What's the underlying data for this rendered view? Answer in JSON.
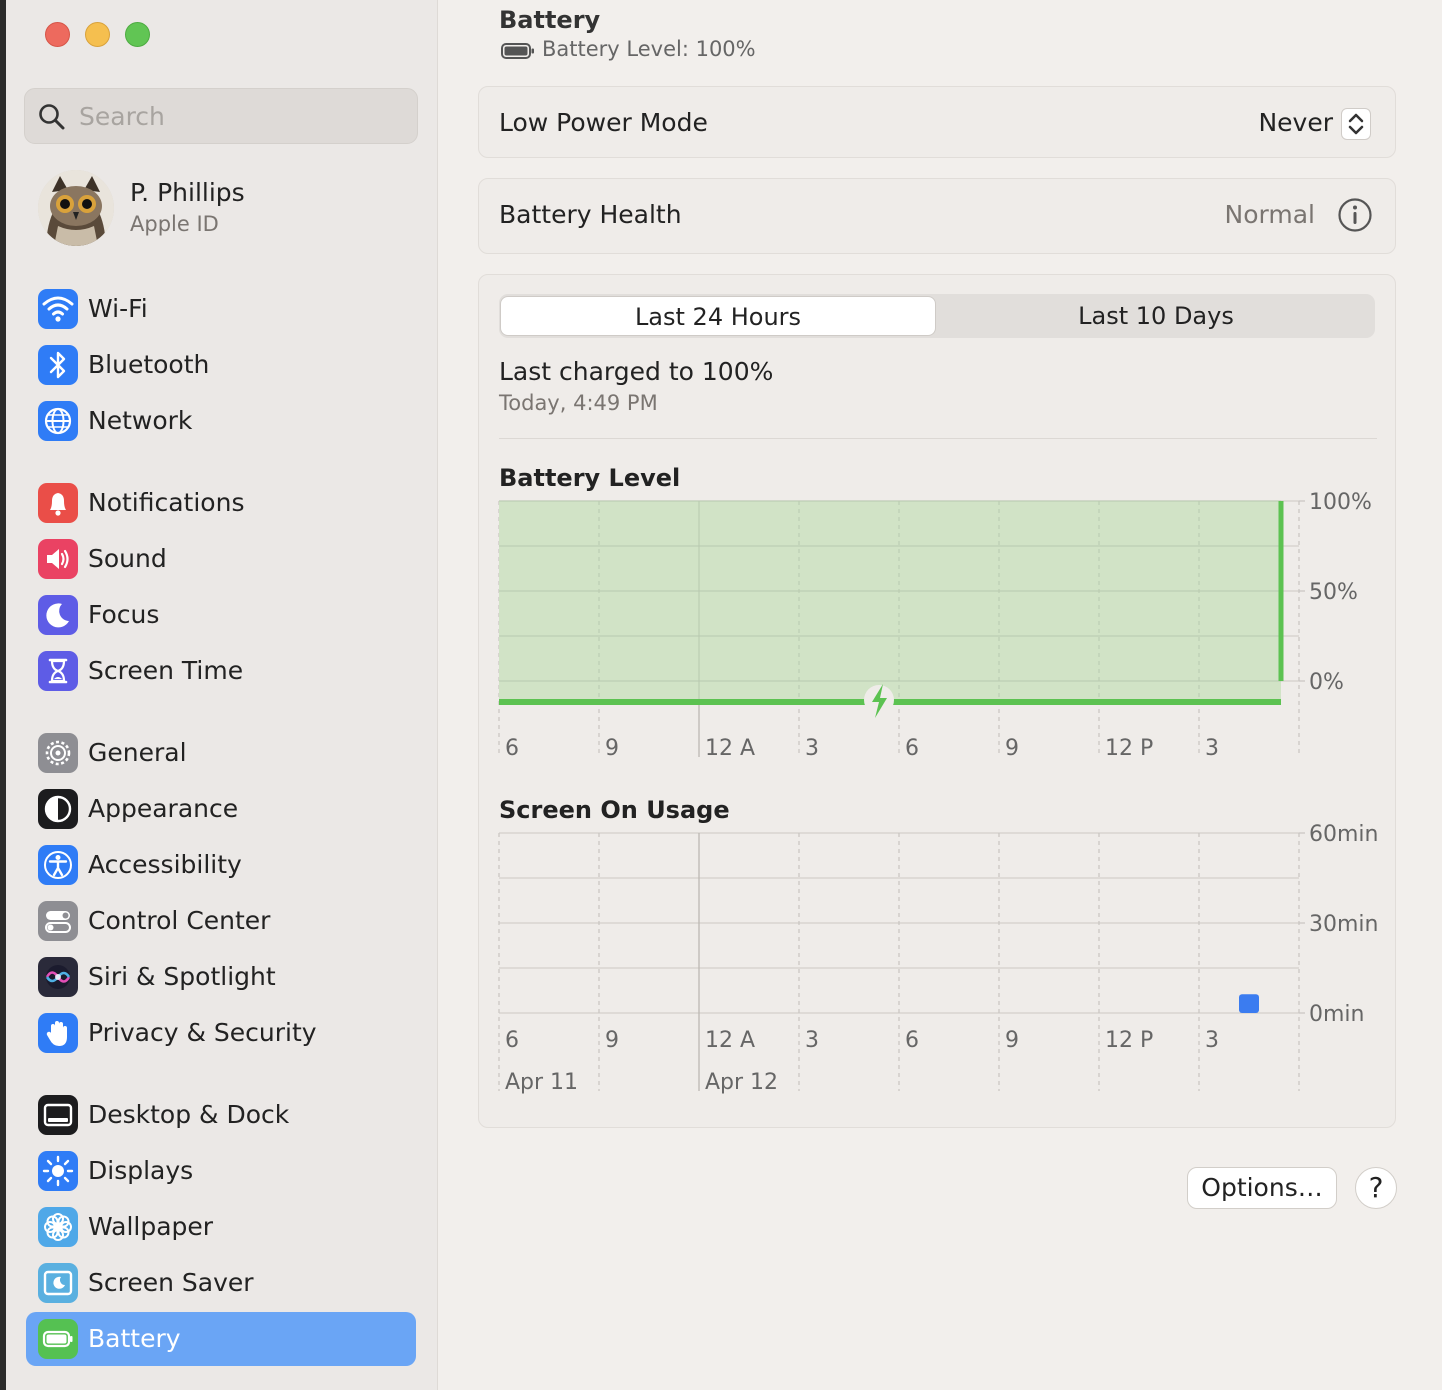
{
  "sidebar": {
    "search": {
      "placeholder": "Search",
      "value": ""
    },
    "account": {
      "name": "P. Phillips",
      "subtitle": "Apple ID"
    },
    "groups": [
      [
        {
          "label": "Wi-Fi",
          "icon": "wifi-icon",
          "color": "#2f7cf6"
        },
        {
          "label": "Bluetooth",
          "icon": "bluetooth-icon",
          "color": "#2f7cf6"
        },
        {
          "label": "Network",
          "icon": "globe-icon",
          "color": "#2f7cf6"
        }
      ],
      [
        {
          "label": "Notifications",
          "icon": "bell-icon",
          "color": "#ea4e48"
        },
        {
          "label": "Sound",
          "icon": "speaker-icon",
          "color": "#ea4263"
        },
        {
          "label": "Focus",
          "icon": "moon-icon",
          "color": "#5e5ce6"
        },
        {
          "label": "Screen Time",
          "icon": "hourglass-icon",
          "color": "#5e5ce6"
        }
      ],
      [
        {
          "label": "General",
          "icon": "gear-icon",
          "color": "#8e8e93"
        },
        {
          "label": "Appearance",
          "icon": "appearance-icon",
          "color": "#1c1c1e"
        },
        {
          "label": "Accessibility",
          "icon": "accessibility-icon",
          "color": "#2f7cf6"
        },
        {
          "label": "Control Center",
          "icon": "toggles-icon",
          "color": "#8e8e93"
        },
        {
          "label": "Siri & Spotlight",
          "icon": "siri-icon",
          "color": "#2a2a3a"
        },
        {
          "label": "Privacy & Security",
          "icon": "hand-icon",
          "color": "#2f7cf6"
        }
      ],
      [
        {
          "label": "Desktop & Dock",
          "icon": "dock-icon",
          "color": "#1c1c1e"
        },
        {
          "label": "Displays",
          "icon": "sun-icon",
          "color": "#2f7cf6"
        },
        {
          "label": "Wallpaper",
          "icon": "flower-icon",
          "color": "#4fa8e8"
        },
        {
          "label": "Screen Saver",
          "icon": "screensaver-icon",
          "color": "#5ab0e0"
        },
        {
          "label": "Battery",
          "icon": "battery-icon",
          "color": "#55c152",
          "selected": true
        }
      ]
    ]
  },
  "main": {
    "title": "Battery",
    "battery_level_text": "Battery Level: 100%",
    "low_power_mode": {
      "label": "Low Power Mode",
      "value": "Never"
    },
    "battery_health": {
      "label": "Battery Health",
      "value": "Normal"
    },
    "tabs": [
      {
        "label": "Last 24 Hours",
        "active": true
      },
      {
        "label": "Last 10 Days",
        "active": false
      }
    ],
    "last_charged": {
      "title": "Last charged to 100%",
      "time": "Today, 4:49 PM"
    },
    "options_label": "Options…",
    "help_label": "?"
  },
  "chart_data": [
    {
      "type": "area",
      "title": "Battery Level",
      "x": [
        "6",
        "9",
        "12 A",
        "3",
        "6",
        "9",
        "12 P",
        "3"
      ],
      "y_ticks": [
        "100%",
        "50%",
        "0%"
      ],
      "ylim": [
        0,
        100
      ],
      "fill_color": "#cfe3c4",
      "line_color": "#5cc251",
      "series": [
        {
          "values": [
            100,
            100,
            100,
            100,
            100,
            100,
            100,
            100
          ]
        }
      ],
      "charging_marker_x": "6",
      "grid": true
    },
    {
      "type": "bar",
      "title": "Screen On Usage",
      "x": [
        "6",
        "9",
        "12 A",
        "3",
        "6",
        "9",
        "12 P",
        "3"
      ],
      "date_labels": [
        {
          "at": "6",
          "label": "Apr 11"
        },
        {
          "at": "12 A",
          "label": "Apr 12"
        }
      ],
      "y_ticks": [
        "60min",
        "30min",
        "0min"
      ],
      "ylim": [
        0,
        60
      ],
      "bar_color": "#3b7cf0",
      "series": [
        {
          "values": [
            0,
            0,
            0,
            0,
            0,
            0,
            0,
            10
          ]
        }
      ],
      "grid": true
    }
  ]
}
